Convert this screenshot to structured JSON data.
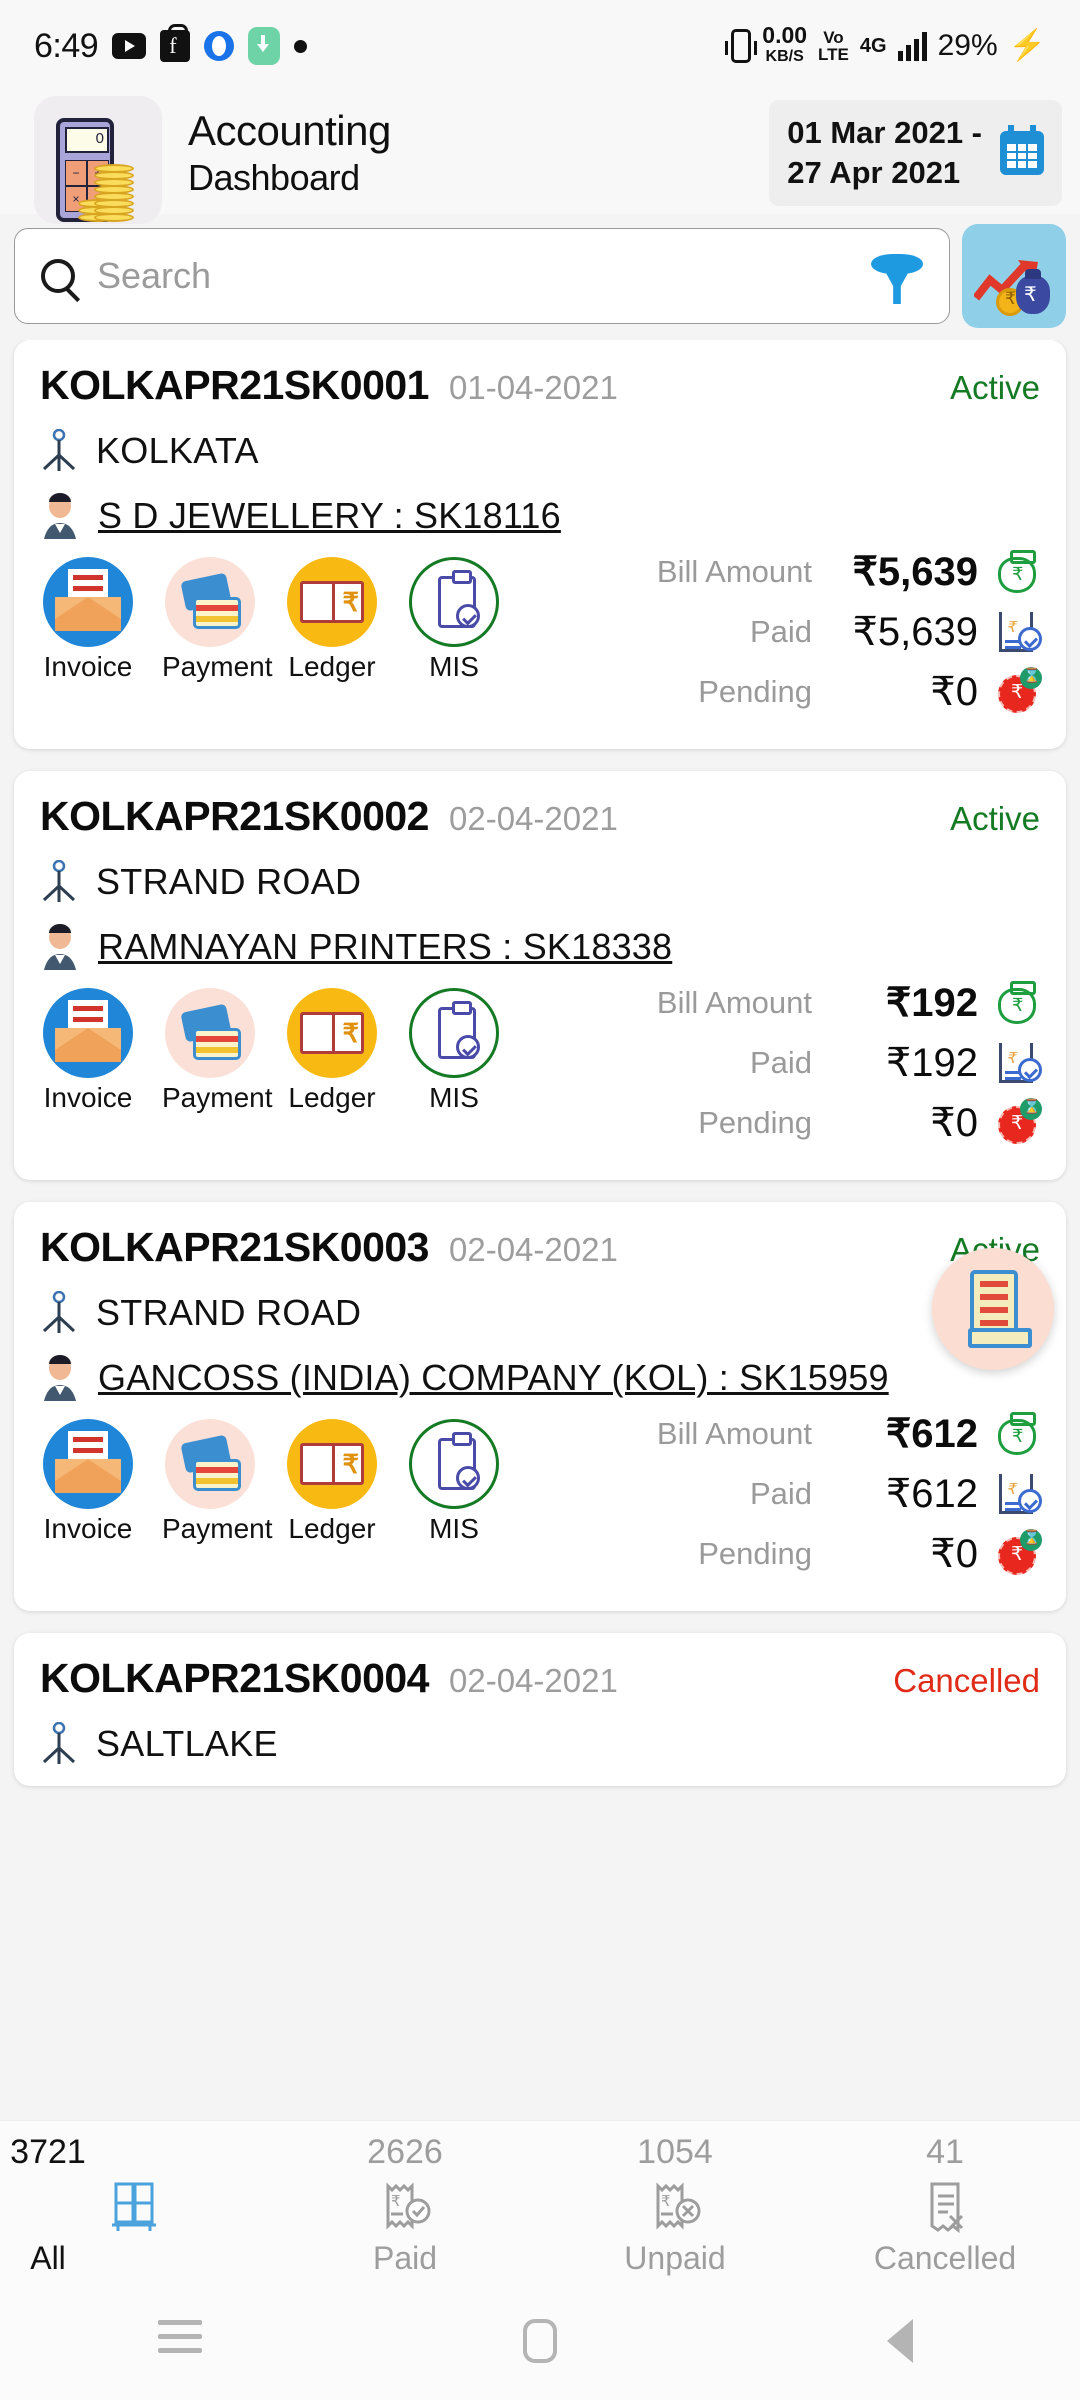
{
  "status_bar": {
    "time": "6:49",
    "app_icons": [
      "youtube-icon",
      "flipkart-icon",
      "opera-icon",
      "download-icon",
      "dot-icon"
    ],
    "net_speed": "0.00",
    "net_speed_unit": "KB/S",
    "volte_top": "Vo",
    "volte_bottom": "LTE",
    "network": "4G",
    "battery": "29%",
    "charging_icon": "bolt-icon"
  },
  "header": {
    "logo_icon": "calculator-coins-icon",
    "title": "Accounting",
    "subtitle": "Dashboard",
    "date_range": "01 Mar 2021  -\n27 Apr 2021",
    "date_from": "01 Mar 2021  -",
    "date_to": "27 Apr 2021",
    "calendar_icon": "calendar-icon"
  },
  "search": {
    "placeholder": "Search",
    "search_icon": "search-icon",
    "filter_icon": "funnel-filter-icon",
    "analytics_icon": "growth-money-icon"
  },
  "labels": {
    "bill_amount": "Bill Amount",
    "paid": "Paid",
    "pending": "Pending",
    "invoice": "Invoice",
    "payment": "Payment",
    "ledger": "Ledger",
    "mis": "MIS"
  },
  "colors": {
    "active": "#157a24",
    "cancelled": "#e02b18",
    "accent_blue": "#2086d8",
    "analytics_bg": "#8fd0e8",
    "fab_bg": "#fbddd1",
    "page_bg": "#f4f4f4"
  },
  "cards": [
    {
      "id": "KOLKAPR21SK0001",
      "date": "01-04-2021",
      "status": "Active",
      "status_type": "active",
      "location": "KOLKATA",
      "party": "S D JEWELLERY : SK18116",
      "bill_amount": "₹5,639",
      "paid": "₹5,639",
      "pending": "₹0"
    },
    {
      "id": "KOLKAPR21SK0002",
      "date": "02-04-2021",
      "status": "Active",
      "status_type": "active",
      "location": "STRAND ROAD",
      "party": "RAMNAYAN PRINTERS : SK18338",
      "bill_amount": "₹192",
      "paid": "₹192",
      "pending": "₹0"
    },
    {
      "id": "KOLKAPR21SK0003",
      "date": "02-04-2021",
      "status": "Active",
      "status_type": "active",
      "location": "STRAND ROAD",
      "party": "GANCOSS (INDIA) COMPANY (KOL) : SK15959",
      "bill_amount": "₹612",
      "paid": "₹612",
      "pending": "₹0"
    },
    {
      "id": "KOLKAPR21SK0004",
      "date": "02-04-2021",
      "status": "Cancelled",
      "status_type": "cancelled",
      "location": "SALTLAKE",
      "party": "",
      "bill_amount": "",
      "paid": "",
      "pending": ""
    }
  ],
  "fab": {
    "icon": "invoice-scroll-icon"
  },
  "bottom_tabs": [
    {
      "count": "3721",
      "label": "All",
      "icon": "boxes-stack-icon",
      "active": true
    },
    {
      "count": "2626",
      "label": "Paid",
      "icon": "receipt-check-icon",
      "active": false
    },
    {
      "count": "1054",
      "label": "Unpaid",
      "icon": "receipt-cross-icon",
      "active": false
    },
    {
      "count": "41",
      "label": "Cancelled",
      "icon": "document-cross-icon",
      "active": false
    }
  ],
  "nav_bar": {
    "recents_icon": "recents-icon",
    "home_icon": "home-icon",
    "back_icon": "back-icon"
  }
}
